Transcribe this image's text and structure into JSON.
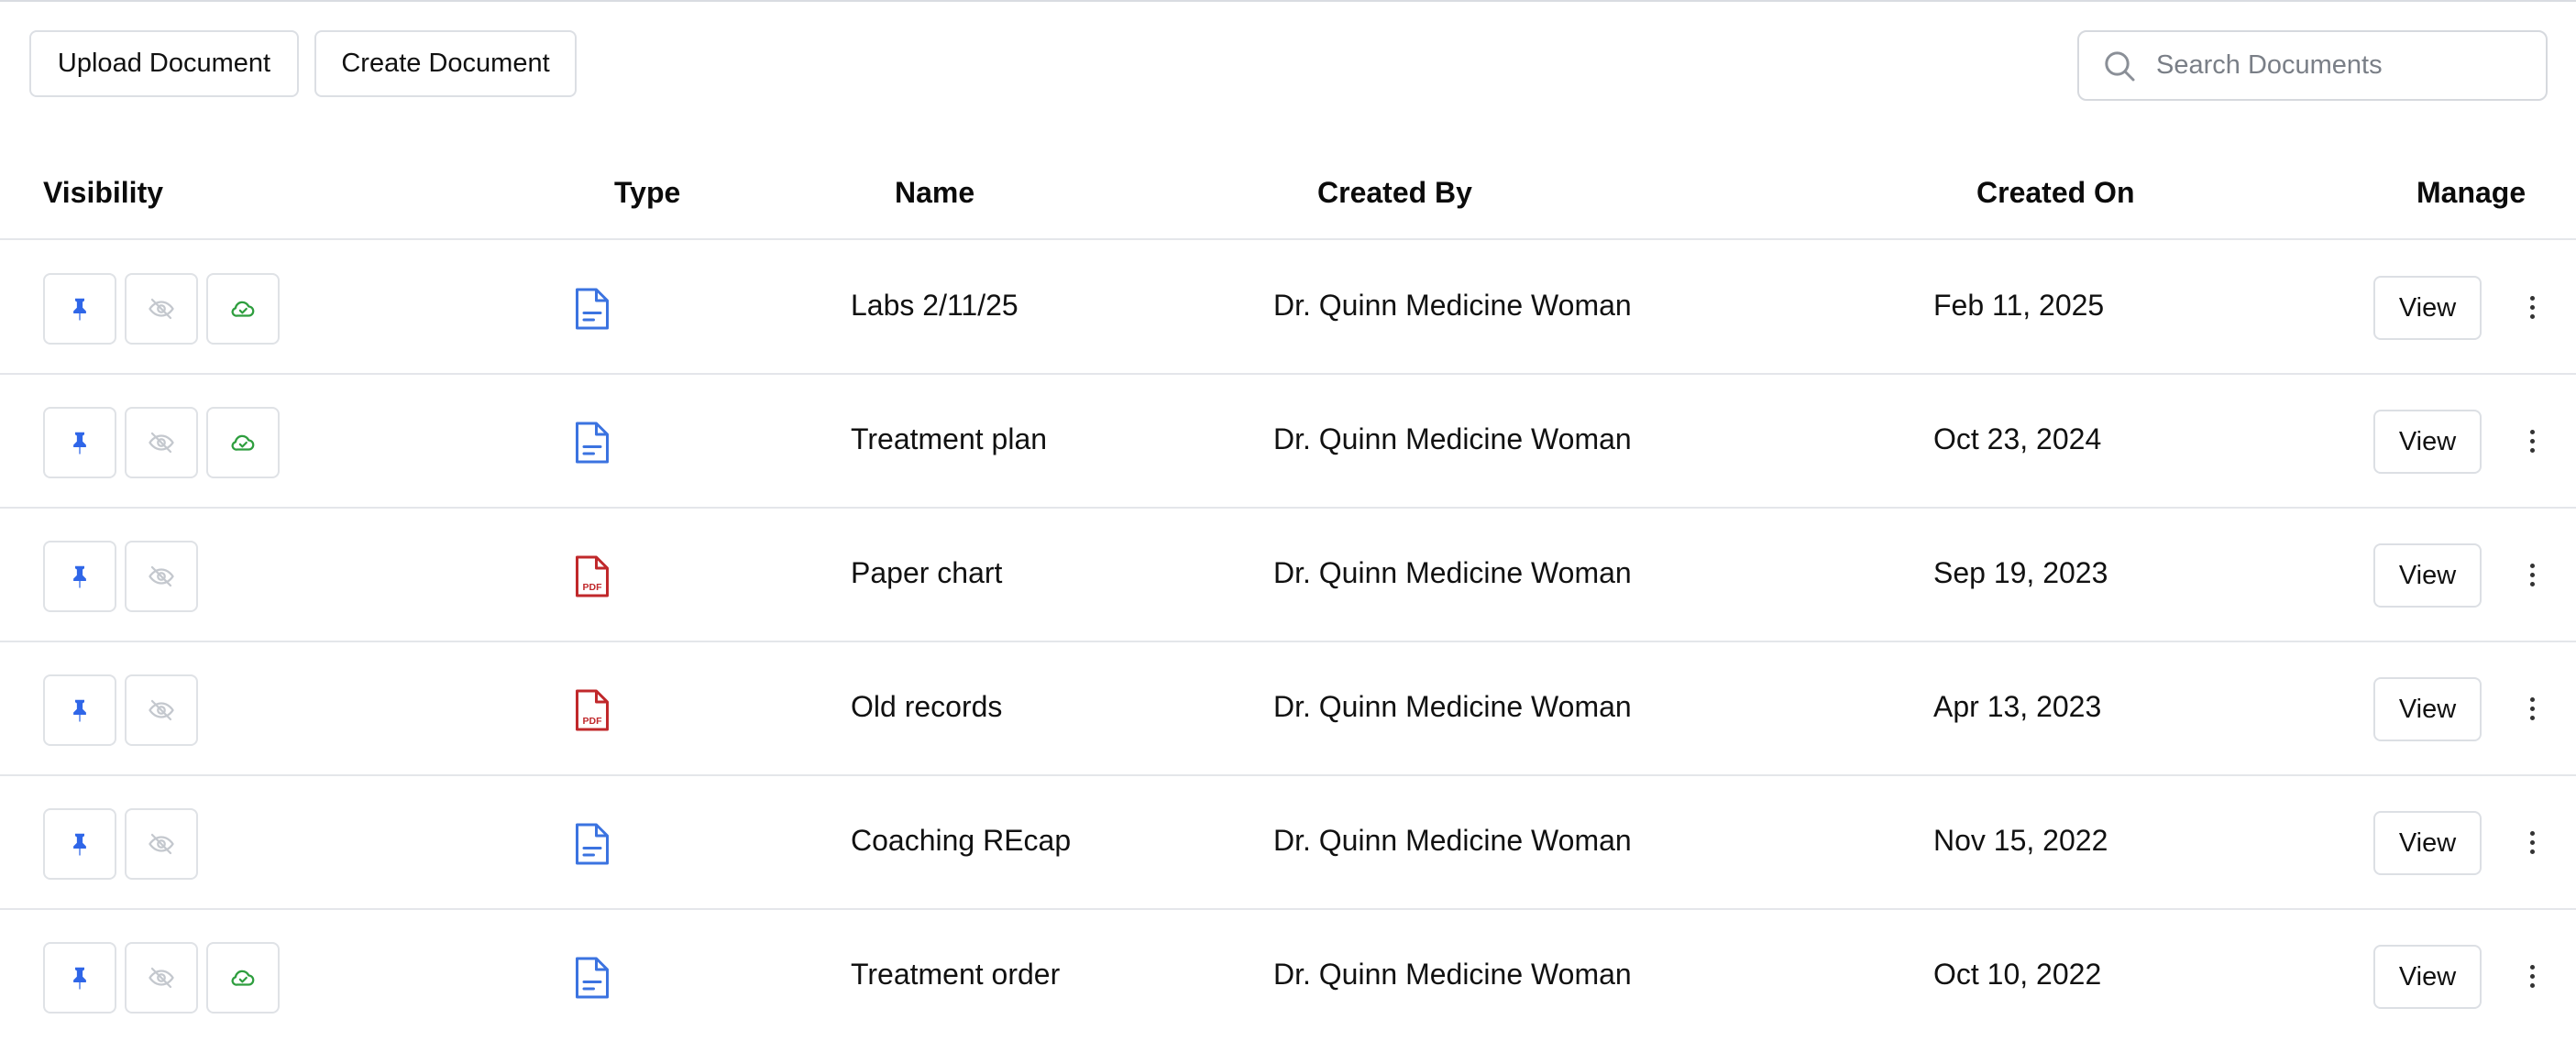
{
  "toolbar": {
    "upload_label": "Upload Document",
    "create_label": "Create Document"
  },
  "search": {
    "placeholder": "Search Documents"
  },
  "table": {
    "headers": {
      "visibility": "Visibility",
      "type": "Type",
      "name": "Name",
      "created_by": "Created By",
      "created_on": "Created On",
      "manage": "Manage"
    },
    "rows": [
      {
        "name": "Labs 2/11/25",
        "created_by": "Dr. Quinn Medicine Woman",
        "created_on": "Feb 11, 2025",
        "type_icon": "document-icon",
        "cloud": true,
        "view_label": "View"
      },
      {
        "name": "Treatment plan",
        "created_by": "Dr. Quinn Medicine Woman",
        "created_on": "Oct 23, 2024",
        "type_icon": "document-icon",
        "cloud": true,
        "view_label": "View"
      },
      {
        "name": "Paper chart",
        "created_by": "Dr. Quinn Medicine Woman",
        "created_on": "Sep 19, 2023",
        "type_icon": "pdf-icon",
        "pdf_label": "PDF",
        "cloud": false,
        "view_label": "View"
      },
      {
        "name": "Old records",
        "created_by": "Dr. Quinn Medicine Woman",
        "created_on": "Apr 13, 2023",
        "type_icon": "pdf-icon",
        "pdf_label": "PDF",
        "cloud": false,
        "view_label": "View"
      },
      {
        "name": "Coaching REcap",
        "created_by": "Dr. Quinn Medicine Woman",
        "created_on": "Nov 15, 2022",
        "type_icon": "document-icon",
        "cloud": false,
        "view_label": "View"
      },
      {
        "name": "Treatment order",
        "created_by": "Dr. Quinn Medicine Woman",
        "created_on": "Oct 10, 2022",
        "type_icon": "document-icon",
        "cloud": true,
        "view_label": "View"
      }
    ]
  },
  "colors": {
    "pin": "#2f66e8",
    "eye_off": "#c4c8ce",
    "cloud": "#2e9e3e",
    "doc": "#3b73e0",
    "pdf": "#c0282b"
  }
}
